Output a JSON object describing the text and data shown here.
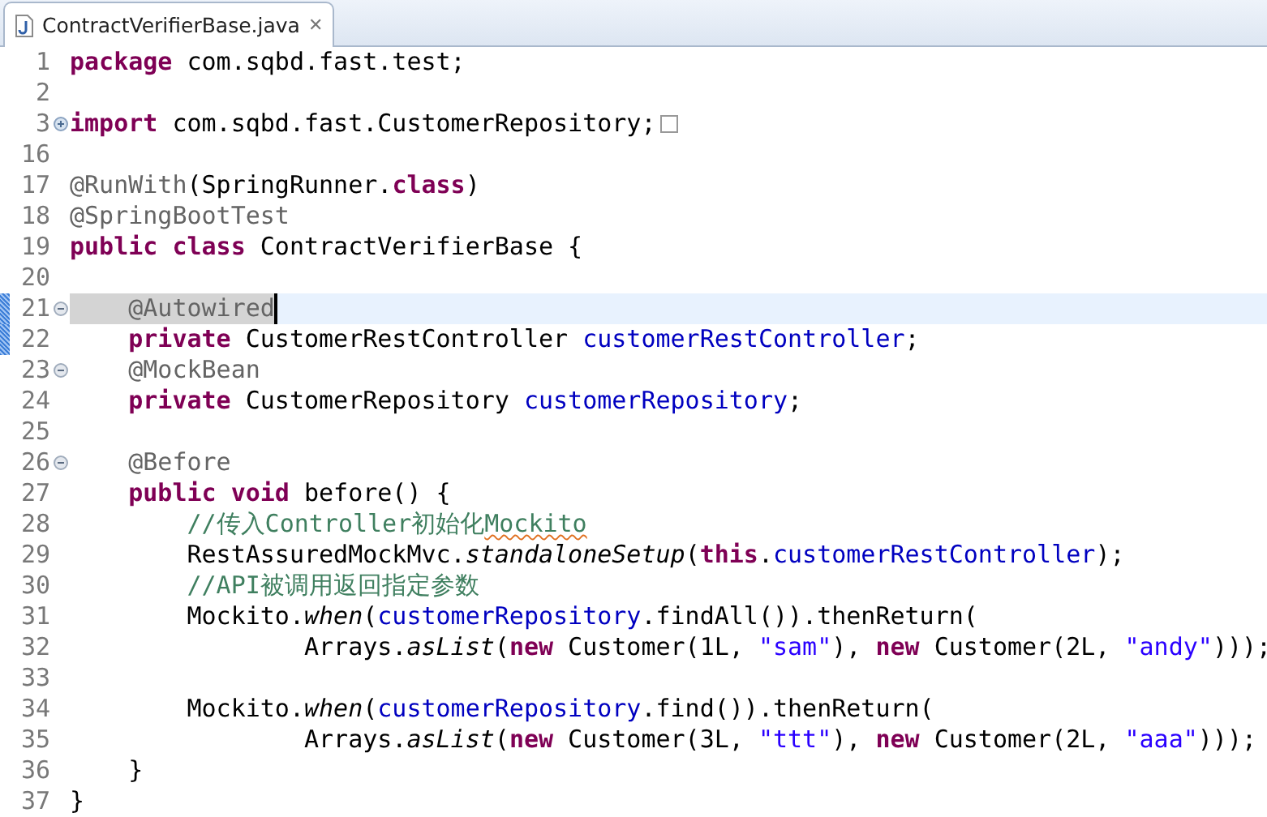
{
  "editor_tab": {
    "title": "ContractVerifierBase.java",
    "close": "✕",
    "selected": true
  },
  "lines": [
    {
      "number": "1",
      "current": false,
      "changed": false,
      "tokens": [
        {
          "text": "package",
          "kind": "keyword"
        },
        {
          "text": " com.sqbd.fast.test;",
          "kind": "plain"
        }
      ]
    },
    {
      "number": "2",
      "current": false,
      "changed": false
    },
    {
      "number": "3",
      "current": false,
      "changed": false,
      "fold": {
        "expanded": false
      },
      "folded_marker": true,
      "tokens": [
        {
          "text": "import",
          "kind": "keyword"
        },
        {
          "text": " com.sqbd.fast.CustomerRepository;",
          "kind": "plain"
        }
      ]
    },
    {
      "number": "16",
      "current": false,
      "changed": false
    },
    {
      "number": "17",
      "current": false,
      "changed": false,
      "tokens": [
        {
          "text": "@RunWith",
          "kind": "annotation"
        },
        {
          "text": "(SpringRunner.",
          "kind": "plain"
        },
        {
          "text": "class",
          "kind": "keyword"
        },
        {
          "text": ")",
          "kind": "plain"
        }
      ]
    },
    {
      "number": "18",
      "current": false,
      "changed": false,
      "tokens": [
        {
          "text": "@SpringBootTest",
          "kind": "annotation"
        }
      ]
    },
    {
      "number": "19",
      "current": false,
      "changed": false,
      "tokens": [
        {
          "text": "public ",
          "kind": "keyword"
        },
        {
          "text": "class",
          "kind": "keyword"
        },
        {
          "text": " ContractVerifierBase {",
          "kind": "plain"
        }
      ]
    },
    {
      "number": "20",
      "current": false,
      "changed": false
    },
    {
      "number": "21",
      "current": true,
      "changed": true,
      "fold": {
        "expanded": true
      },
      "tokens": [
        {
          "text": "    @Autowired",
          "kind": "annotation",
          "occurrence": true,
          "caret": true
        }
      ]
    },
    {
      "number": "22",
      "current": false,
      "changed": true,
      "tokens": [
        {
          "text": "    private",
          "kind": "keyword"
        },
        {
          "text": " CustomerRestController ",
          "kind": "plain"
        },
        {
          "text": "customerRestController",
          "kind": "field"
        },
        {
          "text": ";",
          "kind": "plain"
        }
      ]
    },
    {
      "number": "23",
      "current": false,
      "changed": false,
      "fold": {
        "expanded": true
      },
      "tokens": [
        {
          "text": "    @MockBean",
          "kind": "annotation"
        }
      ]
    },
    {
      "number": "24",
      "current": false,
      "changed": false,
      "tokens": [
        {
          "text": "    private",
          "kind": "keyword"
        },
        {
          "text": " CustomerRepository ",
          "kind": "plain"
        },
        {
          "text": "customerRepository",
          "kind": "field"
        },
        {
          "text": ";",
          "kind": "plain"
        }
      ]
    },
    {
      "number": "25",
      "current": false,
      "changed": false
    },
    {
      "number": "26",
      "current": false,
      "changed": false,
      "fold": {
        "expanded": true
      },
      "tokens": [
        {
          "text": "    @Before",
          "kind": "annotation"
        }
      ]
    },
    {
      "number": "27",
      "current": false,
      "changed": false,
      "tokens": [
        {
          "text": "    public ",
          "kind": "keyword"
        },
        {
          "text": "void",
          "kind": "keyword"
        },
        {
          "text": " before() {",
          "kind": "plain"
        }
      ]
    },
    {
      "number": "28",
      "current": false,
      "changed": false,
      "tokens": [
        {
          "text": "        //传入Controller初始化",
          "kind": "comment"
        },
        {
          "text": "Mockito",
          "kind": "comment",
          "misspelled": true
        }
      ]
    },
    {
      "number": "29",
      "current": false,
      "changed": false,
      "tokens": [
        {
          "text": "        RestAssuredMockMvc.",
          "kind": "plain"
        },
        {
          "text": "standaloneSetup",
          "kind": "static"
        },
        {
          "text": "(",
          "kind": "plain"
        },
        {
          "text": "this",
          "kind": "keyword"
        },
        {
          "text": ".",
          "kind": "plain"
        },
        {
          "text": "customerRestController",
          "kind": "field"
        },
        {
          "text": ");",
          "kind": "plain"
        }
      ]
    },
    {
      "number": "30",
      "current": false,
      "changed": false,
      "tokens": [
        {
          "text": "        //API被调用返回指定参数",
          "kind": "comment"
        }
      ]
    },
    {
      "number": "31",
      "current": false,
      "changed": false,
      "tokens": [
        {
          "text": "        Mockito.",
          "kind": "plain"
        },
        {
          "text": "when",
          "kind": "static"
        },
        {
          "text": "(",
          "kind": "plain"
        },
        {
          "text": "customerRepository",
          "kind": "field"
        },
        {
          "text": ".findAll()).thenReturn(",
          "kind": "plain"
        }
      ]
    },
    {
      "number": "32",
      "current": false,
      "changed": false,
      "tokens": [
        {
          "text": "                Arrays.",
          "kind": "plain"
        },
        {
          "text": "asList",
          "kind": "static"
        },
        {
          "text": "(",
          "kind": "plain"
        },
        {
          "text": "new",
          "kind": "keyword"
        },
        {
          "text": " Customer(1L, ",
          "kind": "plain"
        },
        {
          "text": "\"sam\"",
          "kind": "string"
        },
        {
          "text": "), ",
          "kind": "plain"
        },
        {
          "text": "new",
          "kind": "keyword"
        },
        {
          "text": " Customer(2L, ",
          "kind": "plain"
        },
        {
          "text": "\"andy\"",
          "kind": "string"
        },
        {
          "text": ")));",
          "kind": "plain"
        }
      ]
    },
    {
      "number": "33",
      "current": false,
      "changed": false
    },
    {
      "number": "34",
      "current": false,
      "changed": false,
      "tokens": [
        {
          "text": "        Mockito.",
          "kind": "plain"
        },
        {
          "text": "when",
          "kind": "static"
        },
        {
          "text": "(",
          "kind": "plain"
        },
        {
          "text": "customerRepository",
          "kind": "field"
        },
        {
          "text": ".find()).thenReturn(",
          "kind": "plain"
        }
      ]
    },
    {
      "number": "35",
      "current": false,
      "changed": false,
      "tokens": [
        {
          "text": "                Arrays.",
          "kind": "plain"
        },
        {
          "text": "asList",
          "kind": "static"
        },
        {
          "text": "(",
          "kind": "plain"
        },
        {
          "text": "new",
          "kind": "keyword"
        },
        {
          "text": " Customer(3L, ",
          "kind": "plain"
        },
        {
          "text": "\"ttt\"",
          "kind": "string"
        },
        {
          "text": "), ",
          "kind": "plain"
        },
        {
          "text": "new",
          "kind": "keyword"
        },
        {
          "text": " Customer(2L, ",
          "kind": "plain"
        },
        {
          "text": "\"aaa\"",
          "kind": "string"
        },
        {
          "text": ")));",
          "kind": "plain"
        }
      ]
    },
    {
      "number": "36",
      "current": false,
      "changed": false,
      "tokens": [
        {
          "text": "    }",
          "kind": "plain"
        }
      ]
    },
    {
      "number": "37",
      "current": false,
      "changed": false,
      "tokens": [
        {
          "text": "}",
          "kind": "plain"
        }
      ]
    }
  ]
}
